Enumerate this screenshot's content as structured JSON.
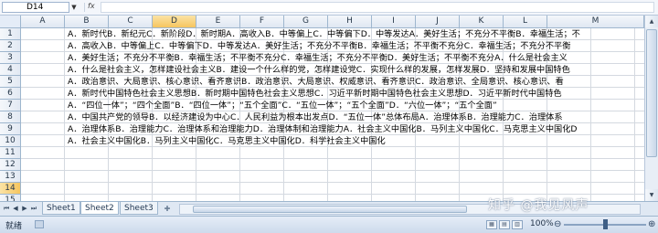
{
  "formula_bar": {
    "name_box": "D14",
    "fx_label": "fx",
    "content": ""
  },
  "columns": [
    "A",
    "B",
    "C",
    "D",
    "E",
    "F",
    "G",
    "H",
    "I",
    "J",
    "K",
    "L",
    "M"
  ],
  "active_column": "D",
  "rows": [
    "1",
    "2",
    "3",
    "4",
    "5",
    "6",
    "7",
    "8",
    "9",
    "10",
    "11",
    "12",
    "13",
    "14",
    "15"
  ],
  "active_row": "14",
  "row_contents": [
    "A．新时代B．新纪元C．新阶段D．新时期A．高收入B．中等偏上C．中等偏下D．中等发达A．美好生活；不充分不平衡B．幸福生活；不",
    "A．高收入B．中等偏上C．中等偏下D．中等发达A．美好生活；不充分不平衡B．幸福生活；不平衡不充分C．幸福生活；不充分不平衡",
    "A．美好生活；不充分不平衡B．幸福生活；不平衡不充分C．幸福生活；不充分不平衡D．美好生活；不平衡不充分A．什么是社会主义",
    "A．什么是社会主义，怎样建设社会主义B．建设一个什么样的党，怎样建设党C．实现什么样的发展，怎样发展D．坚持和发展中国特色",
    "A．政治意识、大局意识、核心意识、看齐意识B．政治意识、大局意识、权威意识、看齐意识C．政治意识、全局意识、核心意识、看",
    "A．新时代中国特色社会主义思想B．新时期中国特色社会主义思想C．习近平新时期中国特色社会主义思想D．习近平新时代中国特色",
    "A．“四位一体”；“四个全面”B．“四位一体”；“五个全面”C．“五位一体”；“五个全面”D．“六位一体”；“五个全面”",
    "A．中国共产党的领导B．以经济建设为中心C．人民利益为根本出发点D．“五位一体”总体布局A．治理体系B．治理能力C．治理体系",
    "A．治理体系B．治理能力C．治理体系和治理能力D．治理体制和治理能力A．社会主义中国化B．马列主义中国化C．马克思主义中国化D",
    "A．社会主义中国化B．马列主义中国化C．马克思主义中国化D．科学社会主义中国化"
  ],
  "sheet_tabs": [
    "Sheet1",
    "Sheet2",
    "Sheet3"
  ],
  "active_sheet": "Sheet2",
  "status": {
    "ready": "就绪",
    "zoom": "100%",
    "zoom_level": 0.5
  },
  "watermark": "知乎 @我见风声"
}
